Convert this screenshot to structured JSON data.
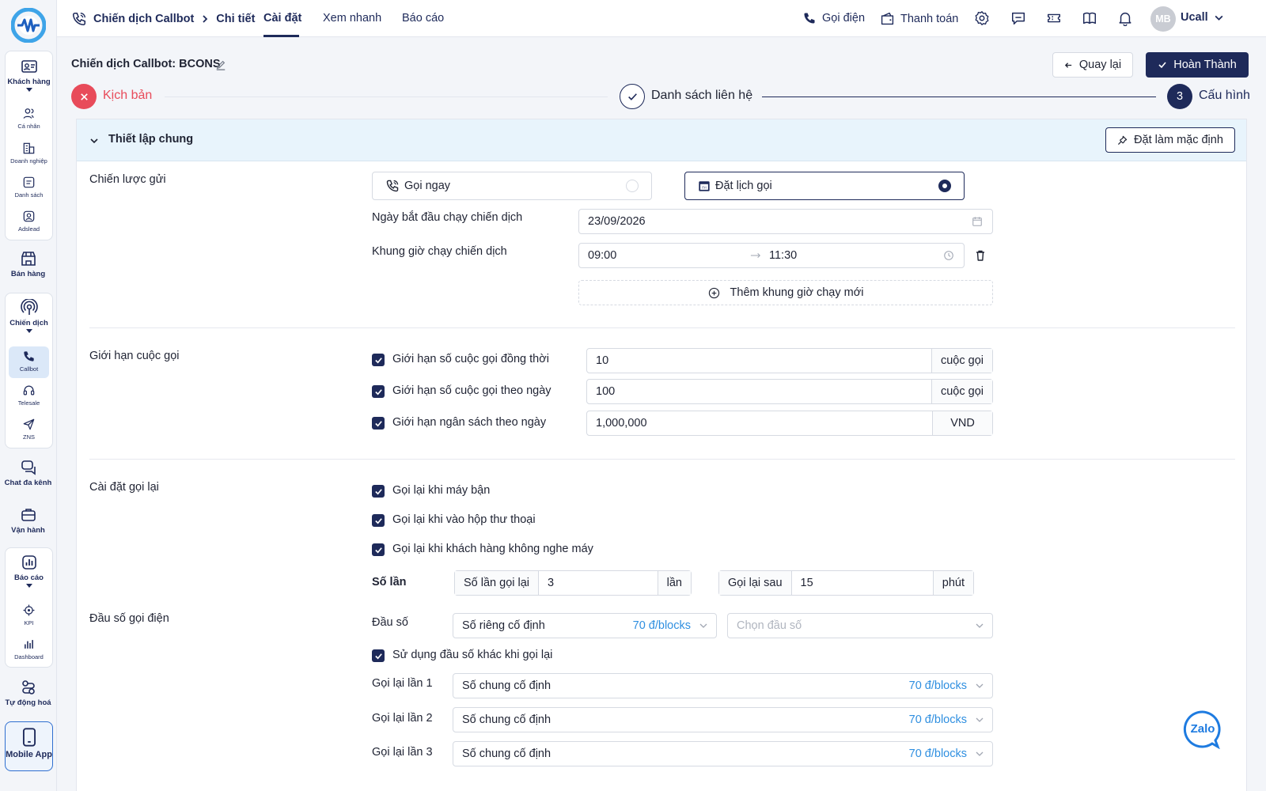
{
  "nav": {
    "groups": [
      {
        "label": "Khách hàng",
        "icon": "contact-card-icon",
        "children": [
          {
            "label": "Cá nhân",
            "icon": "users-icon"
          },
          {
            "label": "Doanh nghiệp",
            "icon": "building-icon"
          },
          {
            "label": "Danh sách",
            "icon": "list-icon"
          },
          {
            "label": "Adslead",
            "icon": "user-circle-icon"
          }
        ]
      },
      {
        "label": "Bán hàng",
        "icon": "shop-icon"
      },
      {
        "label": "Chiến dịch",
        "icon": "broadcast-icon",
        "children": [
          {
            "label": "Callbot",
            "icon": "phone-icon",
            "active": true
          },
          {
            "label": "Telesale",
            "icon": "headset-icon"
          },
          {
            "label": "ZNS",
            "icon": "send-icon"
          }
        ]
      },
      {
        "label": "Chat đa kênh",
        "icon": "chat-icon"
      },
      {
        "label": "Vận hành",
        "icon": "briefcase-icon"
      },
      {
        "label": "Báo cáo",
        "icon": "report-icon",
        "children": [
          {
            "label": "KPI",
            "icon": "target-icon"
          },
          {
            "label": "Dashboard",
            "icon": "bar-chart-icon"
          }
        ]
      },
      {
        "label": "Tự động hoá",
        "icon": "automation-icon"
      },
      {
        "label": "Mobile App",
        "icon": "mobile-icon"
      }
    ]
  },
  "topbar": {
    "breadcrumb": [
      "Chiến dịch Callbot",
      "Chi tiết"
    ],
    "tabs": [
      "Cài đặt",
      "Xem nhanh",
      "Báo cáo"
    ],
    "active_tab": "Cài đặt",
    "call_label": "Gọi điện",
    "payment_label": "Thanh toán",
    "avatar_initials": "MB",
    "user_name": "Ucall"
  },
  "header": {
    "title": "Chiến dịch Callbot: BCONS",
    "back_label": "Quay lại",
    "finish_label": "Hoàn Thành"
  },
  "steps": [
    {
      "label": "Kịch bản",
      "status": "error"
    },
    {
      "label": "Danh sách liên hệ",
      "status": "done"
    },
    {
      "label": "Cấu hình",
      "status": "active",
      "number": "3"
    }
  ],
  "general": {
    "title": "Thiết lập chung",
    "default_button": "Đặt làm mặc định",
    "send_strategy": {
      "label": "Chiến lược gửi",
      "options": [
        "Gọi ngay",
        "Đặt lịch gọi"
      ],
      "selected": "Đặt lịch gọi",
      "start_date_label": "Ngày bắt đầu chạy chiến dịch",
      "start_date": "23/09/2026",
      "time_frame_label": "Khung giờ chạy chiến dịch",
      "time_from": "09:00",
      "time_to": "11:30",
      "add_time_frame": "Thêm khung giờ chạy mới"
    },
    "call_limit": {
      "label": "Giới hạn cuộc gọi",
      "items": [
        {
          "label": "Giới hạn số cuộc gọi đồng thời",
          "value": "10",
          "unit": "cuộc gọi",
          "checked": true
        },
        {
          "label": "Giới hạn số cuộc gọi theo ngày",
          "value": "100",
          "unit": "cuộc gọi",
          "checked": true
        },
        {
          "label": "Giới hạn ngân sách theo ngày",
          "value": "1,000,000",
          "unit": "VND",
          "checked": true
        }
      ]
    },
    "recall": {
      "label": "Cài đặt gọi lại",
      "options": [
        {
          "label": "Gọi lại khi máy bận",
          "checked": true
        },
        {
          "label": "Gọi lại khi vào hộp thư thoại",
          "checked": true
        },
        {
          "label": "Gọi lại khi khách hàng không nghe máy",
          "checked": true
        }
      ],
      "count_label": "Số lần",
      "retry_label": "Số lần gọi lại",
      "retry_value": "3",
      "retry_unit": "lần",
      "after_label": "Gọi lại sau",
      "after_value": "15",
      "after_unit": "phút"
    },
    "caller_number": {
      "label": "Đầu số gọi điện",
      "field_label": "Đầu số",
      "type": "Số riêng cố định",
      "type_price": "70 đ/blocks",
      "select_placeholder": "Chọn đầu số",
      "use_other_label": "Sử dụng đầu số khác khi gọi lại",
      "use_other_checked": true,
      "recalls": [
        {
          "label": "Gọi lại lần 1",
          "value": "Số chung cố định",
          "price": "70 đ/blocks"
        },
        {
          "label": "Gọi lại lần 2",
          "value": "Số chung cố định",
          "price": "70 đ/blocks"
        },
        {
          "label": "Gọi lại lần 3",
          "value": "Số chung cố định",
          "price": "70 đ/blocks"
        }
      ]
    }
  },
  "zalo_label": "Zalo",
  "colors": {
    "brand": "#1e2a5a",
    "error": "#e84b5a",
    "price": "#2f8fe0",
    "card_header": "#e8f4fc"
  }
}
